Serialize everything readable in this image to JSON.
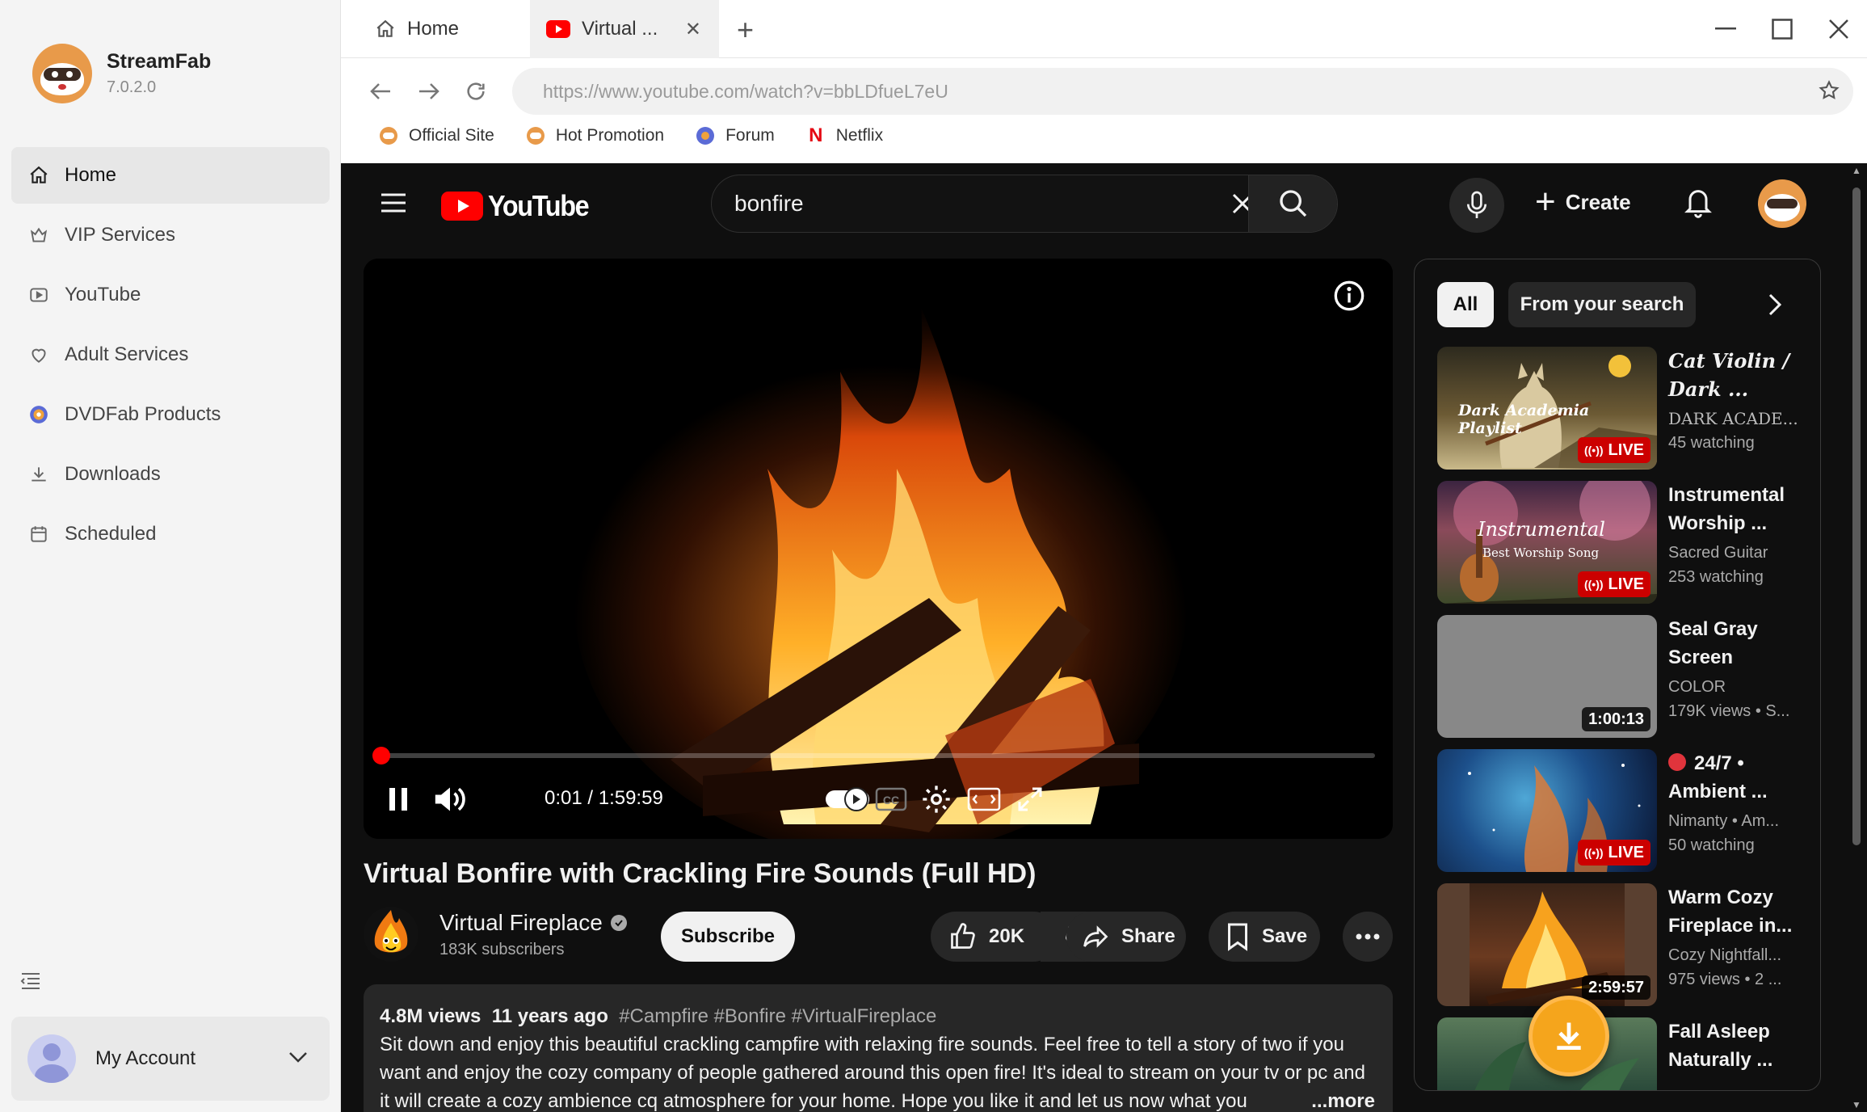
{
  "app": {
    "name": "StreamFab",
    "version": "7.0.2.0"
  },
  "sidebar": {
    "items": [
      {
        "label": "Home",
        "icon": "home-icon",
        "active": true
      },
      {
        "label": "VIP Services",
        "icon": "vip-icon"
      },
      {
        "label": "YouTube",
        "icon": "youtube-icon"
      },
      {
        "label": "Adult Services",
        "icon": "heart-icon"
      },
      {
        "label": "DVDFab Products",
        "icon": "dvdfab-icon"
      },
      {
        "label": "Downloads",
        "icon": "download-icon"
      },
      {
        "label": "Scheduled",
        "icon": "calendar-icon"
      }
    ],
    "account_label": "My Account"
  },
  "browser": {
    "tabs": [
      {
        "label": "Home",
        "icon": "home-icon"
      },
      {
        "label": "Virtual ...",
        "icon": "youtube-icon",
        "active": true
      }
    ],
    "url": "https://www.youtube.com/watch?v=bbLDfueL7eU",
    "bookmarks": [
      {
        "label": "Official Site"
      },
      {
        "label": "Hot Promotion"
      },
      {
        "label": "Forum"
      },
      {
        "label": "Netflix"
      }
    ]
  },
  "youtube": {
    "logo_text": "YouTube",
    "search_query": "bonfire",
    "create_label": "Create",
    "player": {
      "current_time": "0:01",
      "duration": "1:59:59",
      "time_display": "0:01 / 1:59:59",
      "progress": 0.0001
    },
    "video": {
      "title": "Virtual Bonfire with Crackling Fire Sounds (Full HD)",
      "channel": "Virtual Fireplace",
      "subscribers": "183K subscribers",
      "subscribe_label": "Subscribe",
      "likes": "20K",
      "share_label": "Share",
      "save_label": "Save",
      "views": "4.8M views",
      "age": "11 years ago",
      "tags": "#Campfire #Bonfire #VirtualFireplace",
      "description": "Sit down and enjoy this beautiful crackling campfire with relaxing fire sounds. Feel free to tell a story of two if you want and enjoy the cozy company of people gathered around this open fire! It's ideal to stream on your tv or pc and it will create a cozy ambience cq atmosphere for your home. Hope you like it and let us now what you",
      "more_label": "...more"
    },
    "chips": [
      "All",
      "From your search"
    ],
    "recommendations": [
      {
        "title": "Cat Violin / Dark ...",
        "channel": "DARK ACADE...",
        "stats": "45 watching",
        "badge": "LIVE",
        "thumb_text": "Dark Academia Playlist"
      },
      {
        "title": "Instrumental Worship ...",
        "channel": "Sacred Guitar",
        "stats": "253 watching",
        "badge": "LIVE",
        "thumb_text": "Instrumental",
        "thumb_sub": "Best Worship Song"
      },
      {
        "title": "Seal Gray Screen",
        "channel": "COLOR",
        "stats": "179K views • S...",
        "badge": "1:00:13"
      },
      {
        "title": "24/7 • Ambient ...",
        "channel": "Nimanty • Am...",
        "stats": "50 watching",
        "badge": "LIVE"
      },
      {
        "title": "Warm Cozy Fireplace in...",
        "channel": "Cozy Nightfall...",
        "stats": "975 views • 2 ...",
        "badge": "2:59:57"
      },
      {
        "title": "Fall Asleep Naturally ...",
        "channel": "",
        "stats": "",
        "badge": ""
      }
    ]
  },
  "colors": {
    "yt_red": "#ff0000",
    "yt_bg": "#0f0f0f",
    "download_fab": "#f5a51c",
    "sidebar_bg": "#f4f4f4"
  }
}
